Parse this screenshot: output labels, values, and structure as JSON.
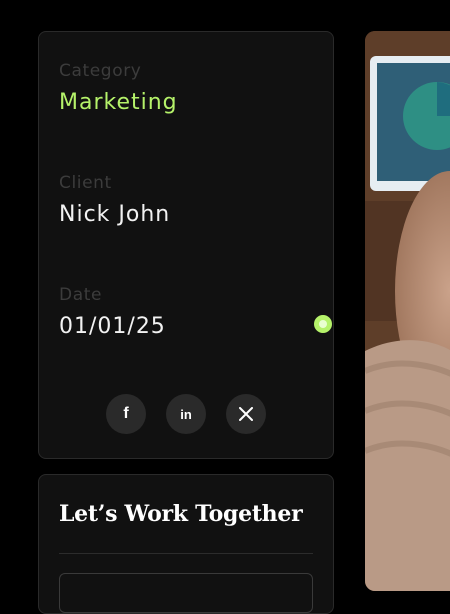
{
  "details": {
    "category_label": "Category",
    "category_value": "Marketing",
    "client_label": "Client",
    "client_value": "Nick John",
    "date_label": "Date",
    "date_value": "01/01/25"
  },
  "social": {
    "facebook_glyph": "f",
    "linkedin_glyph": "in",
    "x_glyph": "𝕏"
  },
  "cta": {
    "title": "Let’s Work Together"
  },
  "colors": {
    "accent": "#b5f26a",
    "card_bg": "#111111",
    "page_bg": "#000000"
  },
  "icons": [
    "facebook-icon",
    "linkedin-icon",
    "x-icon"
  ]
}
